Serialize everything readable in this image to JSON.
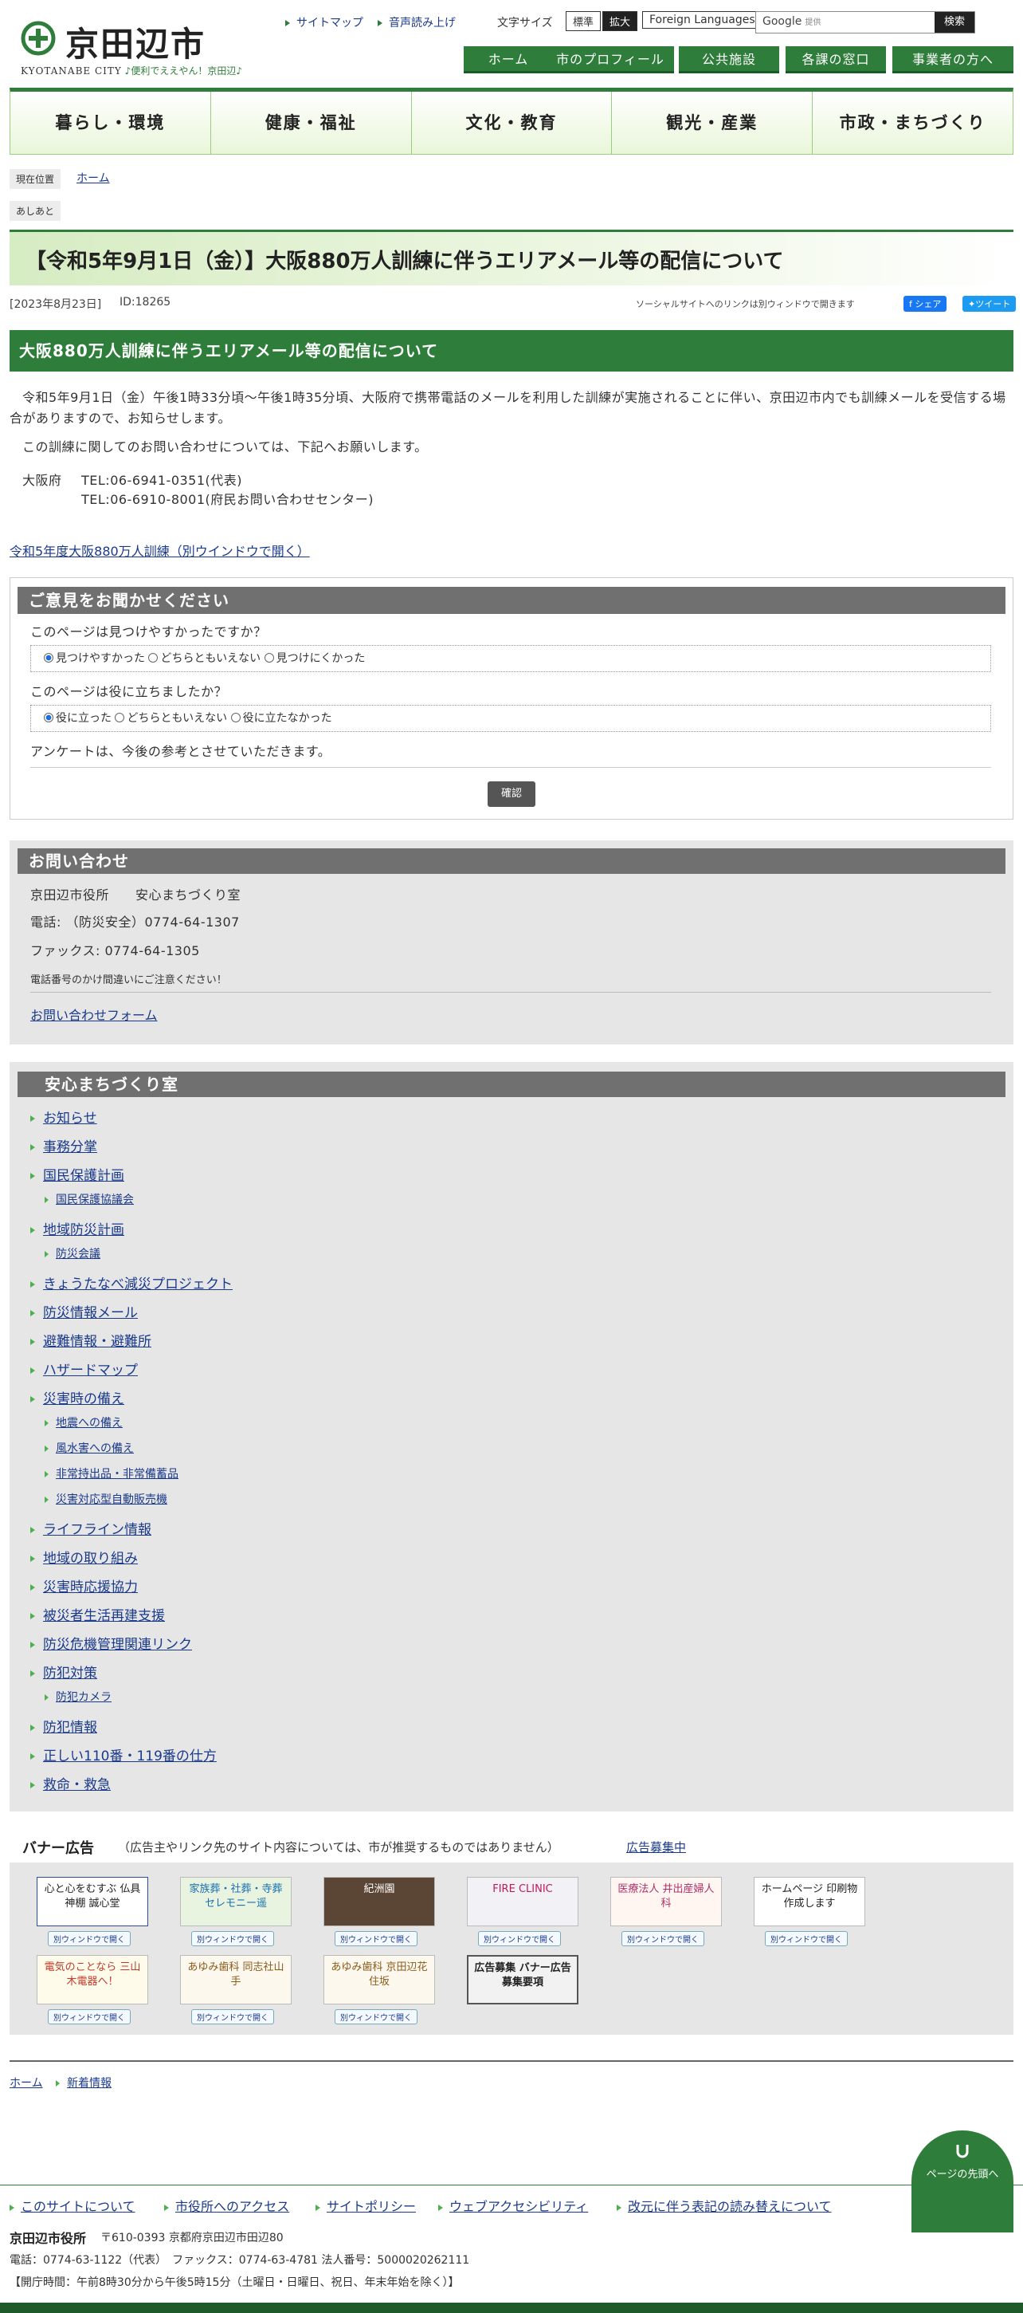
{
  "header": {
    "logo_name": "京田辺市",
    "logo_en": "KYOTANABE CITY",
    "logo_slogan": "♪便利でええやん！京田辺♪",
    "sitemap": "サイトマップ",
    "voice": "音声読み上げ",
    "font_size_label": "文字サイズ",
    "font_standard": "標準",
    "font_large": "拡大",
    "foreign": "Foreign Languages",
    "search_brand": "Google",
    "search_small": "提供",
    "search_button": "検索"
  },
  "topnav": [
    "ホーム",
    "市のプロフィール",
    "公共施設",
    "各課の窓口",
    "事業者の方へ"
  ],
  "gnav": [
    "暮らし・環境",
    "健康・福祉",
    "文化・教育",
    "観光・産業",
    "市政・まちづくり"
  ],
  "breadcrumb": {
    "label": "現在位置",
    "home": "ホーム",
    "footprint": "あしあと"
  },
  "article": {
    "title": "【令和5年9月1日（金）】大阪880万人訓練に伴うエリアメール等の配信について",
    "date": "[2023年8月23日]",
    "id": "ID:18265",
    "sns_note": "ソーシャルサイトへのリンクは別ウィンドウで開きます",
    "share": "シェア",
    "tweet": "ツイート",
    "heading": "大阪880万人訓練に伴うエリアメール等の配信について",
    "para1": "令和5年9月1日（金）午後1時33分頃～午後1時35分頃、大阪府で携帯電話のメールを利用した訓練が実施されることに伴い、京田辺市内でも訓練メールを受信する場合がありますので、お知らせします。",
    "para2": "この訓練に関してのお問い合わせについては、下記へお願いします。",
    "contact_org": "大阪府",
    "tel1": "TEL:06-6941-0351(代表)",
    "tel2": "TEL:06-6910-8001(府民お問い合わせセンター)",
    "link": "令和5年度大阪880万人訓練（別ウインドウで開く）"
  },
  "survey": {
    "heading": "ご意見をお聞かせください",
    "q1": "このページは見つけやすかったですか？",
    "q1_options": [
      "見つけやすかった",
      "どちらともいえない",
      "見つけにくかった"
    ],
    "q2": "このページは役に立ちましたか？",
    "q2_options": [
      "役に立った",
      "どちらともいえない",
      "役に立たなかった"
    ],
    "note": "アンケートは、今後の参考とさせていただきます。",
    "confirm": "確認"
  },
  "inquiry": {
    "heading": "お問い合わせ",
    "office": "京田辺市役所　　安心まちづくり室",
    "phone": "電話: （防災安全）0774-64-1307",
    "fax": "ファックス: 0774-64-1305",
    "caution": "電話番号のかけ間違いにご注意ください！",
    "form": "お問い合わせフォーム"
  },
  "side": {
    "heading": "安心まちづくり室",
    "items": [
      {
        "label": "お知らせ",
        "sub": false
      },
      {
        "label": "事務分掌",
        "sub": false
      },
      {
        "label": "国民保護計画",
        "sub": false
      },
      {
        "label": "国民保護協議会",
        "sub": true
      },
      {
        "label": "地域防災計画",
        "sub": false
      },
      {
        "label": "防災会議",
        "sub": true
      },
      {
        "label": "きょうたなべ減災プロジェクト",
        "sub": false
      },
      {
        "label": "防災情報メール",
        "sub": false
      },
      {
        "label": "避難情報・避難所",
        "sub": false
      },
      {
        "label": "ハザードマップ",
        "sub": false
      },
      {
        "label": "災害時の備え",
        "sub": false
      },
      {
        "label": "地震への備え",
        "sub": true
      },
      {
        "label": "風水害への備え",
        "sub": true
      },
      {
        "label": "非常持出品・非常備蓄品",
        "sub": true
      },
      {
        "label": "災害対応型自動販売機",
        "sub": true
      },
      {
        "label": "ライフライン情報",
        "sub": false
      },
      {
        "label": "地域の取り組み",
        "sub": false
      },
      {
        "label": "災害時応援協力",
        "sub": false
      },
      {
        "label": "被災者生活再建支援",
        "sub": false
      },
      {
        "label": "防災危機管理関連リンク",
        "sub": false
      },
      {
        "label": "防犯対策",
        "sub": false
      },
      {
        "label": "防犯カメラ",
        "sub": true
      },
      {
        "label": "防犯情報",
        "sub": false
      },
      {
        "label": "正しい110番・119番の仕方",
        "sub": false
      },
      {
        "label": "救命・救急",
        "sub": false
      }
    ]
  },
  "banners": {
    "heading": "バナー広告",
    "note": "（広告主やリンク先のサイト内容については、市が推奨するものではありません）",
    "recruit_link": "広告募集中",
    "new_window": "別ウィンドウで開く",
    "items": [
      {
        "text": "心と心をむすぶ 仏具 神棚 誠心堂"
      },
      {
        "text": "家族葬・社葬・寺葬 セレモニー遥"
      },
      {
        "text": "紀洲園"
      },
      {
        "text": "FIRE CLINIC"
      },
      {
        "text": "医療法人 井出産婦人科"
      },
      {
        "text": "ホームページ 印刷物 作成します"
      },
      {
        "text": "電気のことなら 三山木電器へ！"
      },
      {
        "text": "あゆみ歯科 同志社山手"
      },
      {
        "text": "あゆみ歯科 京田辺花住坂"
      },
      {
        "text": "広告募集 バナー広告募集要項"
      }
    ]
  },
  "bottom_crumb": {
    "home": "ホーム",
    "new": "新着情報"
  },
  "pagetop": "ページの先頭へ",
  "footer": {
    "links": [
      "このサイトについて",
      "市役所へのアクセス",
      "サイトポリシー",
      "ウェブアクセシビリティ",
      "改元に伴う表記の読み替えについて"
    ],
    "office": "京田辺市役所",
    "address": "〒610-0393 京都府京田辺市田辺80",
    "tel": "電話：0774-63-1122（代表）　ファックス：0774-63-4781 法人番号：5000020262111",
    "hours": "【開庁時間：午前8時30分から午後5時15分（土曜日・日曜日、祝日、年末年始を除く）】"
  },
  "colors": {
    "brand_green": "#2e7d3a",
    "gray_panel": "#e6e6e6",
    "link": "#1a3a8c"
  }
}
